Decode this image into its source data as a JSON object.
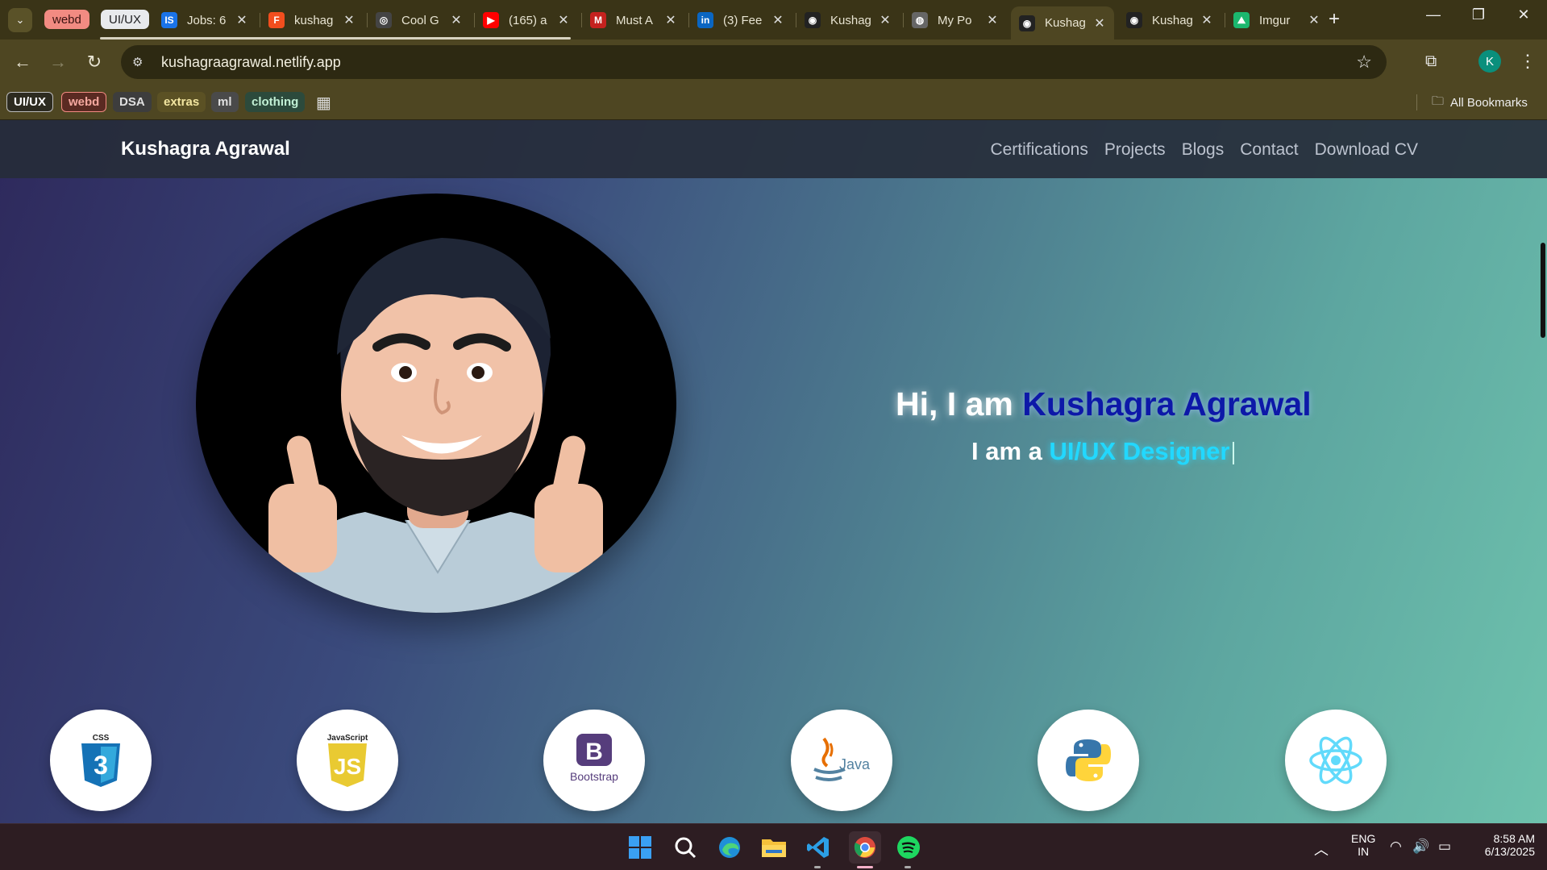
{
  "browser": {
    "tab_groups": [
      {
        "label": "webd",
        "bg": "#f28b82",
        "fg": "#3a1210"
      },
      {
        "label": "UI/UX",
        "bg": "#e8eaed",
        "fg": "#202124"
      }
    ],
    "tabs": [
      {
        "title": "Jobs: 6",
        "fav_text": "IS",
        "fav_bg": "#1a73e8"
      },
      {
        "title": "kushag",
        "fav_text": "F",
        "fav_bg": "#f24e1e"
      },
      {
        "title": "Cool G",
        "fav_text": "◎",
        "fav_bg": "#444"
      },
      {
        "title": "(165) a",
        "fav_text": "▶",
        "fav_bg": "#ff0000"
      },
      {
        "title": "Must A",
        "fav_text": "M",
        "fav_bg": "#c5221f"
      },
      {
        "title": "(3) Fee",
        "fav_text": "in",
        "fav_bg": "#0a66c2"
      },
      {
        "title": "Kushag",
        "fav_text": "◉",
        "fav_bg": "#222"
      },
      {
        "title": "My Po",
        "fav_text": "◍",
        "fav_bg": "#666"
      },
      {
        "title": "Kushag",
        "fav_text": "◉",
        "fav_bg": "#222"
      },
      {
        "title": "Kushag",
        "fav_text": "◉",
        "fav_bg": "#222"
      },
      {
        "title": "Imgur",
        "fav_text": "⛰",
        "fav_bg": "#1bb76e"
      }
    ],
    "active_tab_index": 8,
    "url": "kushagraagrawal.netlify.app",
    "profile_initial": "K",
    "bookmarks": [
      {
        "label": "UI/UX",
        "bg": "#2d2b20",
        "fg": "#ffffff",
        "border": "#bbbbbb"
      },
      {
        "label": "webd",
        "bg": "#5a2a22",
        "fg": "#f5a89f",
        "border": "#f28b82"
      },
      {
        "label": "DSA",
        "bg": "#3d3d3d",
        "fg": "#e0e0e0",
        "border": "none"
      },
      {
        "label": "extras",
        "bg": "#5b5124",
        "fg": "#f3e6a0",
        "border": "none"
      },
      {
        "label": "ml",
        "bg": "#4a4a4a",
        "fg": "#e0e0e0",
        "border": "none"
      },
      {
        "label": "clothing",
        "bg": "#2c4a3c",
        "fg": "#c2f0d5",
        "border": "none"
      }
    ],
    "all_bookmarks": "All Bookmarks"
  },
  "site": {
    "brand": "Kushagra Agrawal",
    "nav": [
      "Certifications",
      "Projects",
      "Blogs",
      "Contact",
      "Download CV"
    ],
    "hero": {
      "greeting": "Hi, I am ",
      "name": "Kushagra Agrawal",
      "prefix": "I am a ",
      "role": "UI/UX Designer"
    },
    "skills": [
      "css3-icon",
      "javascript-icon",
      "bootstrap-icon",
      "java-icon",
      "python-icon",
      "react-icon"
    ],
    "skill_labels": {
      "css": "CSS",
      "js_top": "JavaScript",
      "js": "JS",
      "bootstrap_letter": "B",
      "bootstrap": "Bootstrap",
      "java": "Java"
    }
  },
  "taskbar": {
    "lang_top": "ENG",
    "lang_bottom": "IN",
    "time": "8:58 AM",
    "date": "6/13/2025"
  }
}
